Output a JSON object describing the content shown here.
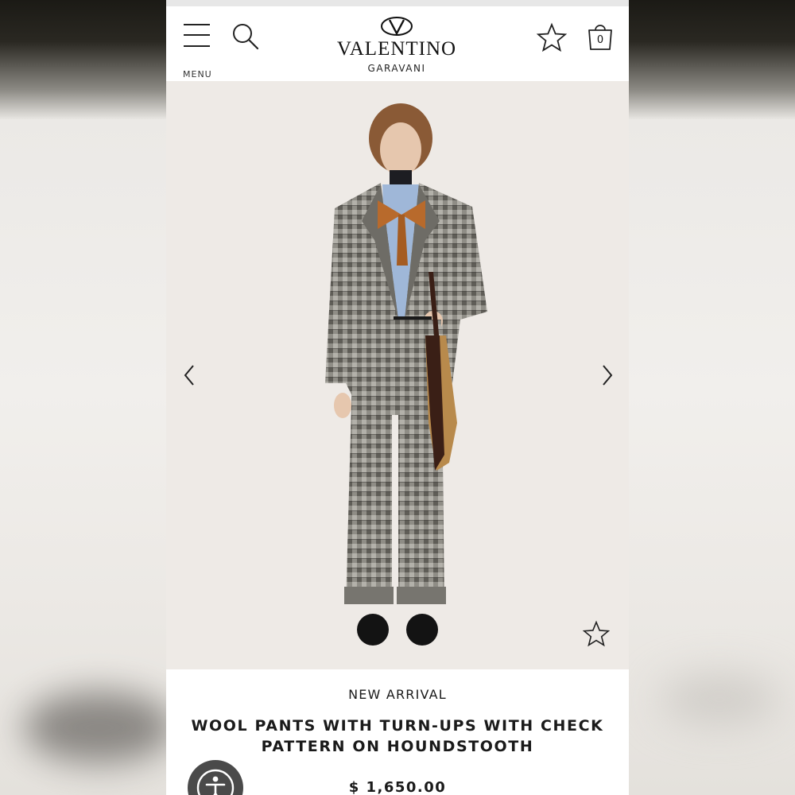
{
  "header": {
    "menu_label": "MENU",
    "brand_name": "VALENTINO",
    "brand_sub": "GARAVANI",
    "bag_count": "0"
  },
  "icons": {
    "menu": "hamburger-icon",
    "search": "search-icon",
    "wishlist": "star-outline-icon",
    "bag": "shopping-bag-icon",
    "prev": "chevron-left-icon",
    "next": "chevron-right-icon",
    "image_wishlist": "star-outline-icon",
    "accessibility": "accessibility-icon"
  },
  "product": {
    "tag": "NEW ARRIVAL",
    "title": "WOOL PANTS WITH TURN-UPS WITH CHECK PATTERN ON HOUNDSTOOTH",
    "price": "$ 1,650.00"
  },
  "colors": {
    "accent": "#1a1a1a",
    "image_background": "#eeeae6",
    "a11y_button": "#4a4a4a"
  }
}
